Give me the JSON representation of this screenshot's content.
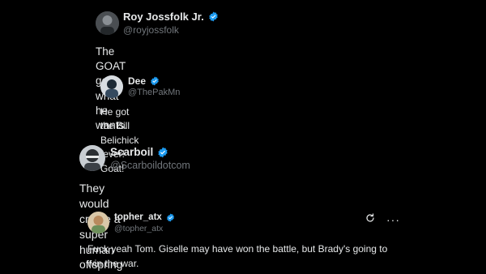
{
  "posts": [
    {
      "name": "Roy Jossfolk Jr.",
      "handle": "@royjossfolk",
      "text": "The GOAT gets what he wants.",
      "avatar_icon": "avatar-photo",
      "verified": true
    },
    {
      "name": "Dee",
      "handle": "@ThePakMn",
      "text": "He got the Bill Belichick fever!\nGoat!",
      "avatar_icon": "avatar-photo",
      "verified": true
    },
    {
      "name": "Scarboil",
      "handle": "@Scarboildotcom",
      "text": "They would create a super human offspring",
      "avatar_icon": "avatar-photo",
      "verified": true
    },
    {
      "name": "topher_atx",
      "handle": "@topher_atx",
      "text": "Fuck yeah Tom. Giselle may have won the battle, but Brady's going to win the war.",
      "avatar_icon": "avatar-photo",
      "verified": true
    }
  ],
  "icons": {
    "verified": "verified-badge-icon",
    "refresh": "refresh-icon",
    "more": "more-options-icon"
  },
  "colors": {
    "background": "#000000",
    "text": "#e7e9ea",
    "muted": "#71767b",
    "verified": "#1d9bf0"
  },
  "more_glyph": "···"
}
